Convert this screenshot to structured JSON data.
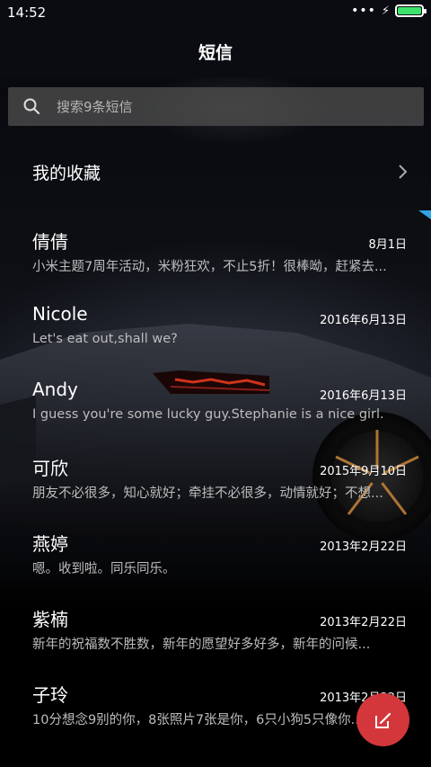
{
  "status": {
    "time": "14:52",
    "dots": "•••"
  },
  "header": {
    "title": "短信"
  },
  "search": {
    "placeholder": "搜索9条短信"
  },
  "favorites": {
    "label": "我的收藏"
  },
  "conversations": [
    {
      "name": "倩倩",
      "date": "8月1日",
      "preview": "小米主题7周年活动，米粉狂欢，不止5折！很棒呦，赶紧去..."
    },
    {
      "name": "Nicole",
      "date": "2016年6月13日",
      "preview": "Let's eat out,shall we?"
    },
    {
      "name": "Andy",
      "date": "2016年6月13日",
      "preview": "I guess you're some lucky guy.Stephanie is a nice girl."
    },
    {
      "name": "可欣",
      "date": "2015年9月10日",
      "preview": "朋友不必很多，知心就好；牵挂不必很多，动情就好；不想..."
    },
    {
      "name": "燕婷",
      "date": "2013年2月22日",
      "preview": "嗯。收到啦。同乐同乐。"
    },
    {
      "name": "紫楠",
      "date": "2013年2月22日",
      "preview": "新年的祝福数不胜数，新年的愿望好多好多，新年的问候..."
    },
    {
      "name": "子玲",
      "date": "2013年2月22日",
      "preview": "10分想念9别的你，8张照片7张是你，6只小狗5只像你..."
    }
  ],
  "icons": {
    "search": "search-icon",
    "chevron": "chevron-right-icon",
    "compose": "compose-icon",
    "battery": "battery-icon",
    "charging": "charging-icon"
  },
  "colors": {
    "fab": "#d4373b",
    "battery": "#3ee36b",
    "accent": "#2fa4e7"
  }
}
